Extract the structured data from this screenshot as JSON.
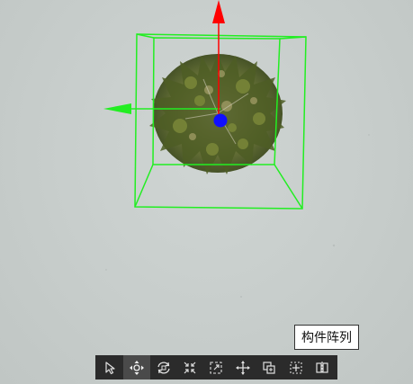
{
  "viewport": {
    "background_color": "#c9cfcd",
    "selection_box_color": "#22ee22",
    "gizmo": {
      "x_axis_color": "#22ee22",
      "y_axis_color": "#ff0000",
      "pivot_color": "#1010ff"
    },
    "object_icon": "tree-top-view"
  },
  "tooltip": {
    "text": "构件阵列"
  },
  "toolbar": {
    "tools": [
      {
        "icon": "select-arrow-icon",
        "active": false
      },
      {
        "icon": "move-cross-icon",
        "active": true
      },
      {
        "icon": "rotate-icon",
        "active": false
      },
      {
        "icon": "scale-in-icon",
        "active": false
      },
      {
        "icon": "scale-out-icon",
        "active": false
      },
      {
        "icon": "move-arrows-icon",
        "active": false
      },
      {
        "icon": "copy-icon",
        "active": false
      },
      {
        "icon": "component-array-icon",
        "active": false
      },
      {
        "icon": "mirror-icon",
        "active": false
      }
    ]
  }
}
